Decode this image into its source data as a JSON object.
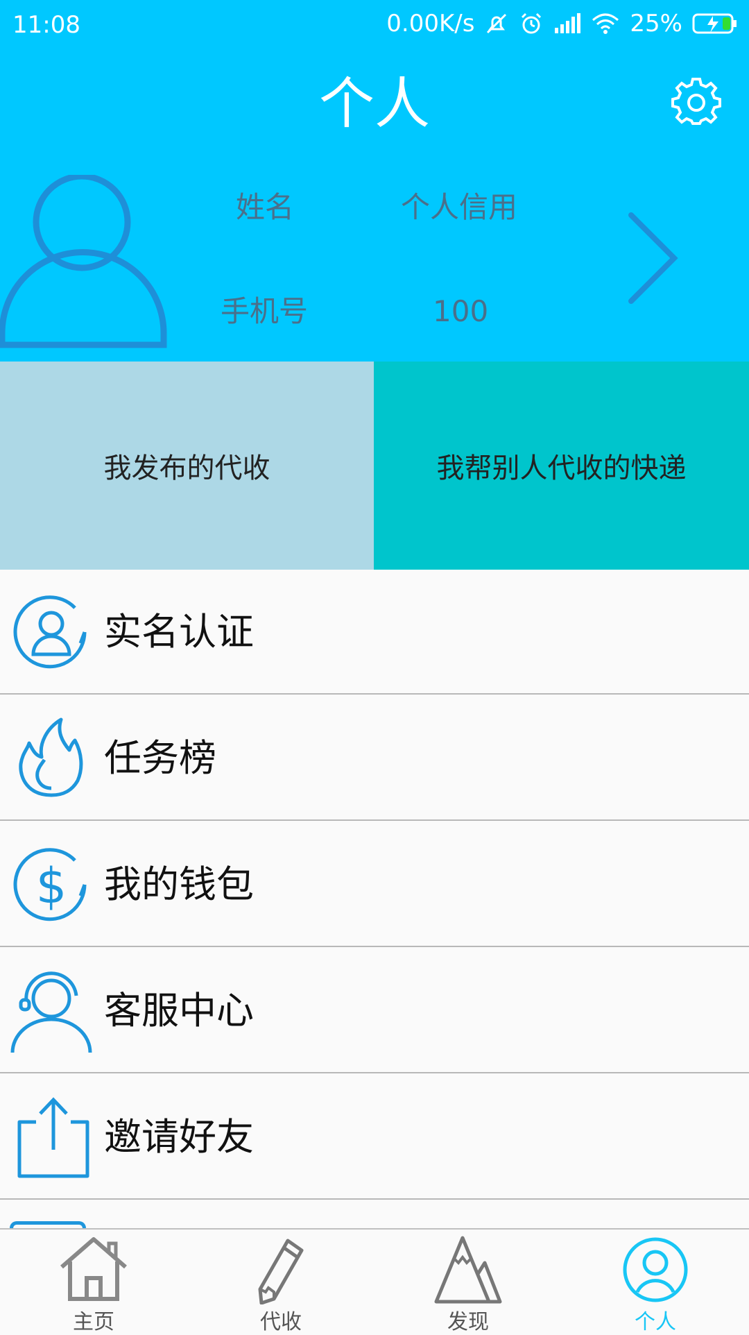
{
  "status_bar": {
    "time": "11:08",
    "network_speed": "0.00K/s",
    "battery": "25%",
    "icons": [
      "mute-icon",
      "alarm-icon",
      "signal-icon",
      "wifi-icon",
      "battery-charging-icon"
    ]
  },
  "header": {
    "title": "个人",
    "settings_icon": "gear-icon"
  },
  "profile": {
    "name_label": "姓名",
    "credit_label": "个人信用",
    "phone_label": "手机号",
    "credit_value": "100"
  },
  "blocks": {
    "left": "我发布的代收",
    "right": "我帮别人代收的快递"
  },
  "menu": [
    {
      "label": "实名认证",
      "icon": "user-verify-icon"
    },
    {
      "label": "任务榜",
      "icon": "flame-icon"
    },
    {
      "label": "我的钱包",
      "icon": "dollar-icon"
    },
    {
      "label": "客服中心",
      "icon": "headset-icon"
    },
    {
      "label": "邀请好友",
      "icon": "share-icon"
    }
  ],
  "nav": [
    {
      "label": "主页",
      "icon": "home-icon"
    },
    {
      "label": "代收",
      "icon": "pencil-icon"
    },
    {
      "label": "发现",
      "icon": "mountain-icon"
    },
    {
      "label": "个人",
      "icon": "user-circle-icon",
      "active": true
    }
  ],
  "colors": {
    "header_bg": "#00c8ff",
    "block_left_bg": "#add8e6",
    "block_right_bg": "#00c5cc",
    "icon_blue": "#1e96dc",
    "active_tab": "#18c6f5"
  }
}
